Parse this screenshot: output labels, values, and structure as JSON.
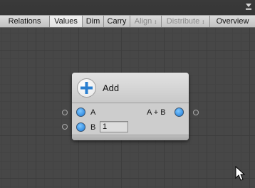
{
  "toolbar": {
    "tabs": [
      {
        "label": "Relations",
        "active": false,
        "enabled": true,
        "dropdown": false
      },
      {
        "label": "Values",
        "active": true,
        "enabled": true,
        "dropdown": false
      },
      {
        "label": "Dim",
        "active": false,
        "enabled": true,
        "dropdown": false
      },
      {
        "label": "Carry",
        "active": false,
        "enabled": true,
        "dropdown": false
      },
      {
        "label": "Align",
        "active": false,
        "enabled": false,
        "dropdown": true
      },
      {
        "label": "Distribute",
        "active": false,
        "enabled": false,
        "dropdown": true
      },
      {
        "label": "Overview",
        "active": false,
        "enabled": true,
        "dropdown": false
      }
    ],
    "dropdown_glyph": "↕"
  },
  "node": {
    "title": "Add",
    "icon": "plus-icon",
    "inputs": [
      {
        "label": "A",
        "value": null
      },
      {
        "label": "B",
        "value": "1"
      }
    ],
    "outputs": [
      {
        "label": "A + B"
      }
    ]
  },
  "colors": {
    "port": "#2a8ae6",
    "canvas": "#474747",
    "node_body": "#cdcdcd"
  }
}
